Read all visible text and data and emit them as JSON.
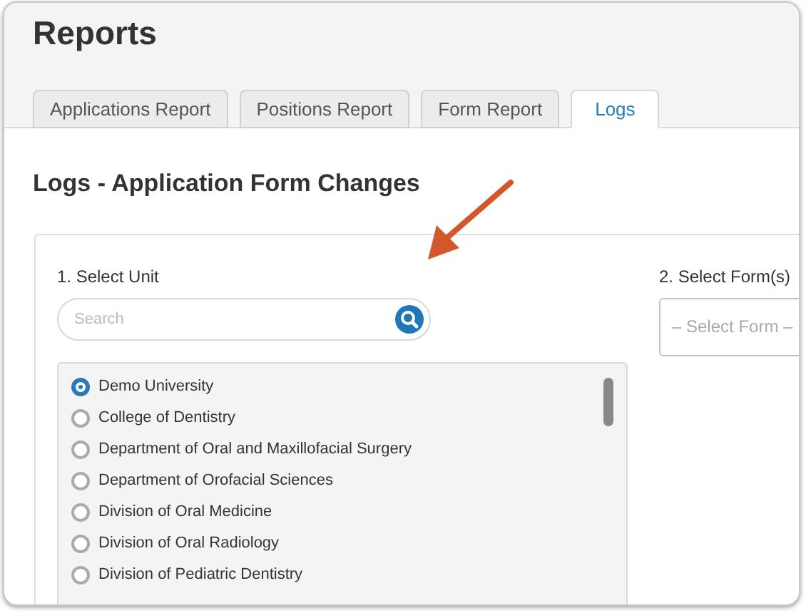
{
  "page": {
    "title": "Reports"
  },
  "tabs": [
    {
      "label": "Applications Report",
      "selected": false
    },
    {
      "label": "Positions Report",
      "selected": false
    },
    {
      "label": "Form Report",
      "selected": false
    },
    {
      "label": "Logs",
      "selected": true
    }
  ],
  "section": {
    "title": "Logs - Application Form Changes"
  },
  "unit": {
    "label": "1. Select Unit",
    "search": {
      "placeholder": "Search"
    },
    "options": [
      {
        "label": "Demo University",
        "selected": true
      },
      {
        "label": "College of Dentistry",
        "selected": false
      },
      {
        "label": "Department of Oral and Maxillofacial Surgery",
        "selected": false
      },
      {
        "label": "Department of Orofacial Sciences",
        "selected": false
      },
      {
        "label": "Division of Oral Medicine",
        "selected": false
      },
      {
        "label": "Division of Oral Radiology",
        "selected": false
      },
      {
        "label": "Division of Pediatric Dentistry",
        "selected": false
      }
    ]
  },
  "forms": {
    "label": "2. Select Form(s)",
    "placeholder": "– Select Form –"
  }
}
